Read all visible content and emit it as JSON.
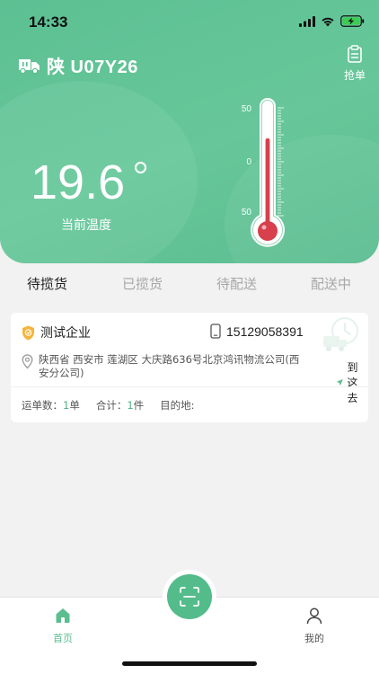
{
  "status_bar": {
    "time": "14:33"
  },
  "header": {
    "plate": "陕 U07Y26",
    "grab_label": "抢单",
    "temperature": "19.6",
    "temperature_label": "当前温度",
    "thermometer": {
      "scale_labels": [
        "50",
        "0",
        "50"
      ]
    }
  },
  "tabs": [
    {
      "label": "待揽货",
      "active": true
    },
    {
      "label": "已揽货",
      "active": false
    },
    {
      "label": "待配送",
      "active": false
    },
    {
      "label": "配送中",
      "active": false
    }
  ],
  "order_card": {
    "company": "测试企业",
    "phone": "15129058391",
    "address": "陕西省 西安市 莲湖区 大庆路636号北京鸿讯物流公司(西安分公司)",
    "navigate_label": "到这去",
    "waybill_label": "运单数：",
    "waybill_count": "1",
    "waybill_unit": "单",
    "total_label": "合计：",
    "total_count": "1",
    "total_unit": "件",
    "destination_label": "目的地:"
  },
  "bottom_nav": {
    "home_label": "首页",
    "mine_label": "我的"
  },
  "colors": {
    "primary": "#5bbd90",
    "accent_number": "#4fb287",
    "thermo_red": "#d7404c"
  }
}
